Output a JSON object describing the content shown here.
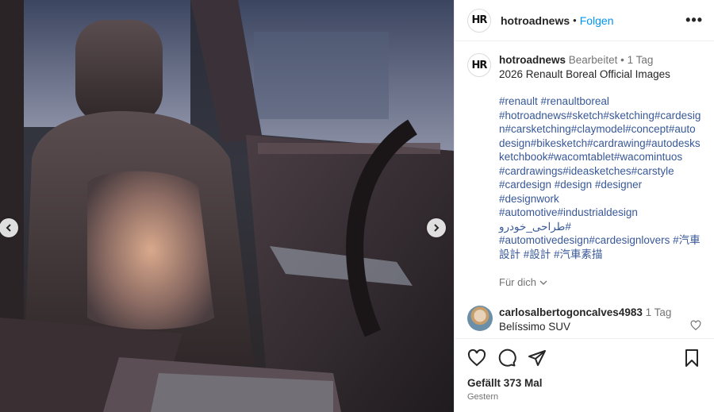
{
  "photo": {
    "alt": "2026 Renault Boreal interior, front seat",
    "prev_icon": "chevron-left-icon",
    "next_icon": "chevron-right-icon"
  },
  "header": {
    "logo_text": "HR",
    "username": "hotroadnews",
    "separator": "•",
    "follow_label": "Folgen",
    "more_label": "•••"
  },
  "caption": {
    "username": "hotroadnews",
    "edited": "Bearbeitet",
    "separator": "•",
    "time": "1 Tag",
    "title": "2026 Renault Boreal Official Images",
    "hashtag_lines": [
      "#renault #renaultboreal",
      "#hotroadnews#sketch#sketching#cardesign#carsketching#claymodel#concept#autodesign#bikesketch#cardrawing#autodesksketchbook#wacomtablet#wacomintuos",
      "#cardrawings#ideasketches#carstyle",
      "#cardesign #design #designer",
      "#designwork",
      "#automotive#industrialdesign",
      "#طراحی_خودرو",
      "#automotivedesign#cardesignlovers #汽車設計 #設計 #汽車素描"
    ],
    "see_translation": "Für dich"
  },
  "comment": {
    "username": "carlosalbertogoncalves4983",
    "time": "1 Tag",
    "text": "Belíssimo SUV"
  },
  "actions": {
    "likes": "Gefällt 373 Mal",
    "timestamp": "Gestern"
  },
  "colors": {
    "follow": "#0095f6",
    "hashtag": "#385898",
    "muted": "#737373"
  }
}
